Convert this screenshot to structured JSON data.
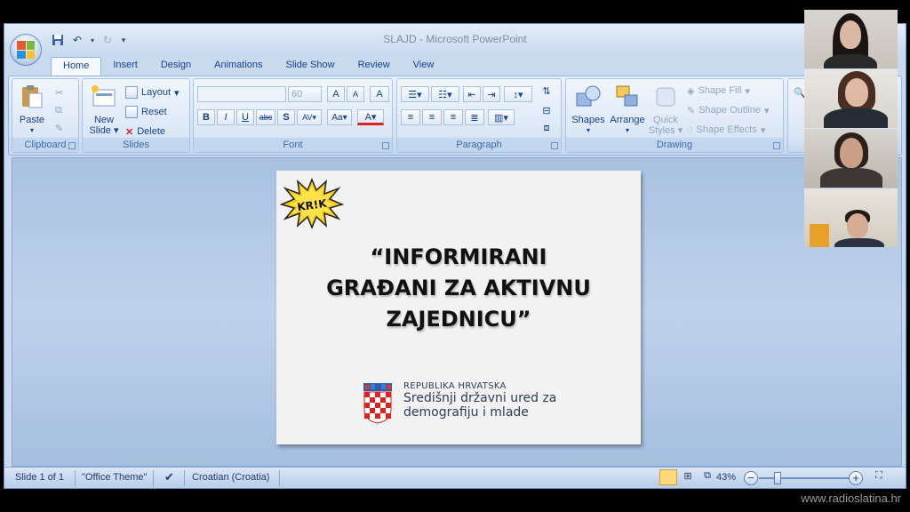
{
  "window": {
    "title": "SLAJD - Microsoft PowerPoint"
  },
  "tabs": [
    {
      "label": "Home",
      "active": true
    },
    {
      "label": "Insert"
    },
    {
      "label": "Design"
    },
    {
      "label": "Animations"
    },
    {
      "label": "Slide Show"
    },
    {
      "label": "Review"
    },
    {
      "label": "View"
    }
  ],
  "ribbon": {
    "clipboard": {
      "label": "Clipboard",
      "paste": "Paste"
    },
    "slides": {
      "label": "Slides",
      "new_slide_1": "New",
      "new_slide_2": "Slide",
      "layout": "Layout",
      "reset": "Reset",
      "delete": "Delete"
    },
    "font": {
      "label": "Font",
      "font_size": "60"
    },
    "paragraph": {
      "label": "Paragraph"
    },
    "drawing": {
      "label": "Drawing",
      "shapes": "Shapes",
      "arrange": "Arrange",
      "quick_styles_1": "Quick",
      "quick_styles_2": "Styles",
      "shape_fill": "Shape Fill",
      "shape_outline": "Shape Outline",
      "shape_effects": "Shape Effects"
    }
  },
  "slide": {
    "logo_text": "KR!K",
    "title": "“INFORMIRANI\nGRAĐANI ZA AKTIVNU\nZAJEDNICU”",
    "gov_line1": "REPUBLIKA HRVATSKA",
    "gov_line2": "Središnji državni ured za",
    "gov_line3": "demografiju i mlade"
  },
  "statusbar": {
    "slide_count": "Slide 1 of 1",
    "theme": "\"Office Theme\"",
    "language": "Croatian (Croatia)",
    "zoom": "43%"
  },
  "watermark": "www.radioslatina.hr",
  "colors": {
    "accent": "#15428b",
    "ribbon_bg": "#dbe7f6",
    "workspace": "#b3c9e6"
  }
}
